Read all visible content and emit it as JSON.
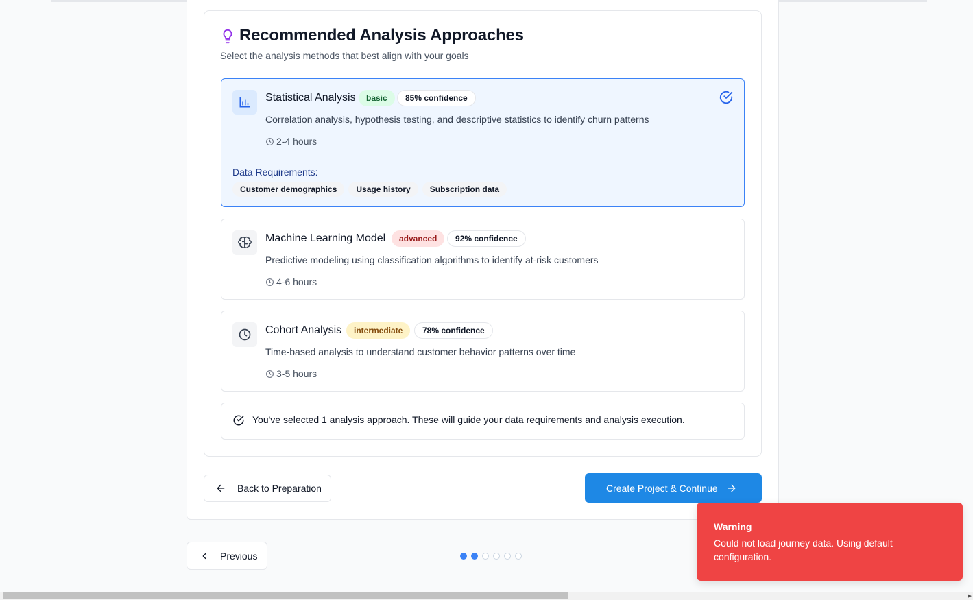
{
  "section": {
    "title": "Recommended Analysis Approaches",
    "subtitle": "Select the analysis methods that best align with your goals"
  },
  "approaches": [
    {
      "name": "Statistical Analysis",
      "level": "basic",
      "confidence": "85% confidence",
      "description": "Correlation analysis, hypothesis testing, and descriptive statistics to identify churn patterns",
      "duration": "2-4 hours",
      "selected": true,
      "icon": "bar-chart-icon",
      "requirements_label": "Data Requirements:",
      "requirements": [
        "Customer demographics",
        "Usage history",
        "Subscription data"
      ]
    },
    {
      "name": "Machine Learning Model",
      "level": "advanced",
      "confidence": "92% confidence",
      "description": "Predictive modeling using classification algorithms to identify at-risk customers",
      "duration": "4-6 hours",
      "selected": false,
      "icon": "brain-icon"
    },
    {
      "name": "Cohort Analysis",
      "level": "intermediate",
      "confidence": "78% confidence",
      "description": "Time-based analysis to understand customer behavior patterns over time",
      "duration": "3-5 hours",
      "selected": false,
      "icon": "clock-icon"
    }
  ],
  "summary": {
    "text": "You've selected 1 analysis approach. These will guide your data requirements and analysis execution."
  },
  "actions": {
    "back_label": "Back to Preparation",
    "create_label": "Create Project & Continue"
  },
  "pager": {
    "previous_label": "Previous",
    "total_steps": 6,
    "current_step": 2
  },
  "toast": {
    "title": "Warning",
    "message": "Could not load journey data. Using default configuration."
  },
  "colors": {
    "primary": "#1e88e5",
    "selected_bg": "#eff6ff",
    "selected_border": "#3b82f6",
    "warning": "#ef4444",
    "bulb": "#9333ea"
  }
}
